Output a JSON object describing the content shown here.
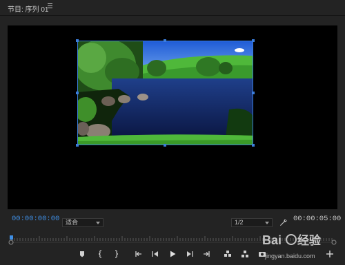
{
  "panel": {
    "title": "节目: 序列 01",
    "menu_icon": "hamburger-menu-icon"
  },
  "timecode": {
    "current": "00:00:00:00",
    "duration": "00:00:05:00"
  },
  "fit_select": {
    "value": "适合"
  },
  "resolution_select": {
    "value": "1/2"
  },
  "playhead": {
    "position_fraction": 0
  },
  "transport_buttons": [
    "add-marker",
    "mark-in",
    "mark-out",
    "go-to-in",
    "step-back",
    "play",
    "step-forward",
    "go-to-out",
    "lift",
    "extract",
    "export-frame",
    "button-editor"
  ],
  "watermark": {
    "text": "Bai度经验",
    "sub": "jingyan.baidu.com"
  },
  "colors": {
    "accent_timecode": "#3f8fe5",
    "selection_handle": "#3b7ddb",
    "panel_bg": "#232323"
  }
}
